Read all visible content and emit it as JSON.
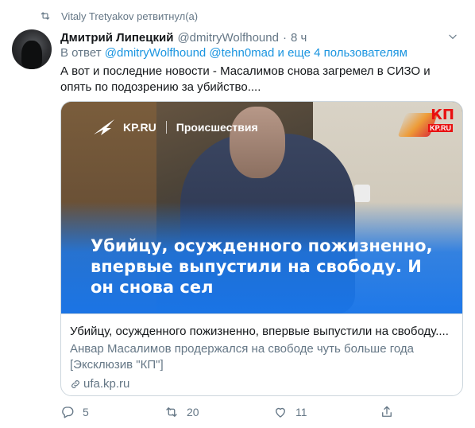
{
  "retweet": {
    "text": "Vitaly Tretyakov ретвитнул(а)",
    "icon": "retweet-icon"
  },
  "tweet": {
    "author_name": "Дмитрий Липецкий",
    "author_handle": "@dmitryWolfhound",
    "dot": "·",
    "time": "8 ч",
    "reply_prefix": "В ответ",
    "reply_mentions": "@dmitryWolfhound @tehn0mad и еще 4 пользователям",
    "text": "А вот и последние новости - Масалимов снова загремел в СИЗО и опять по подозрению за убийство...."
  },
  "card": {
    "brand_name": "KP.RU",
    "brand_section": "Происшествия",
    "corner_logo": "КП",
    "corner_logo_sub": "KP.RU",
    "headline": "Убийцу, осужденного пожизненно, впервые выпустили на свободу. И он снова сел",
    "title": "Убийцу, осужденного пожизненно, впервые выпустили на свободу....",
    "description": "Анвар Масалимов продержался на свободе чуть больше года [Эксклюзив \"КП\"]",
    "domain": "ufa.kp.ru"
  },
  "actions": {
    "reply_count": "5",
    "retweet_count": "20",
    "like_count": "11",
    "reply_icon": "reply-icon",
    "retweet_icon": "retweet-icon",
    "like_icon": "heart-icon",
    "share_icon": "share-icon"
  },
  "colors": {
    "accent": "#1b95e0",
    "secondary_text": "#657786",
    "primary_text": "#14171a",
    "border": "#ccd6dd",
    "overlay_blue": "#1976eb"
  }
}
